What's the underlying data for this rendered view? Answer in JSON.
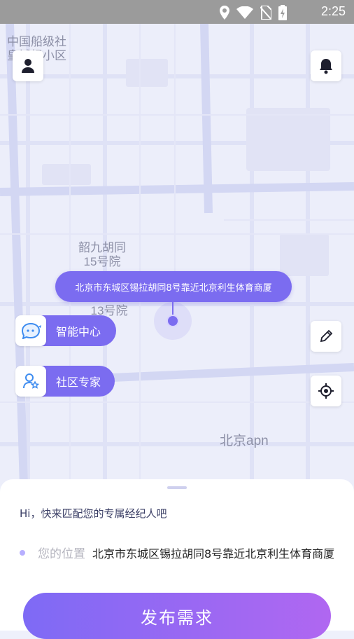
{
  "status_bar": {
    "time": "2:25",
    "icons": [
      "location-icon",
      "wifi-icon",
      "no-sim-icon",
      "battery-charging-icon"
    ]
  },
  "map": {
    "labels": {
      "top_left": "中国船级社\n皇城根小区",
      "hutong_15": "韶九胡同\n15号院",
      "hutong_13": "韶九胡同\n13号院",
      "bottom": "北京apn"
    }
  },
  "address_bubble": {
    "text": "北京市东城区锡拉胡同8号靠近北京利生体育商厦"
  },
  "shortcuts": [
    {
      "label": "智能中心",
      "icon": "chat-robot-icon"
    },
    {
      "label": "社区专家",
      "icon": "expert-user-icon"
    }
  ],
  "buttons": {
    "profile_icon": "user-icon",
    "notification_icon": "bell-icon",
    "edit_icon": "pencil-icon",
    "locate_icon": "locate-icon"
  },
  "sheet": {
    "greeting": "Hi，快来匹配您的专属经纪人吧",
    "location_label": "您的位置",
    "location_value": "北京市东城区锡拉胡同8号靠近北京利生体育商厦",
    "publish_button": "发布需求"
  },
  "colors": {
    "accent": "#7b6cf0",
    "gradient_end": "#b067f1",
    "map_bg": "#eceefa"
  }
}
